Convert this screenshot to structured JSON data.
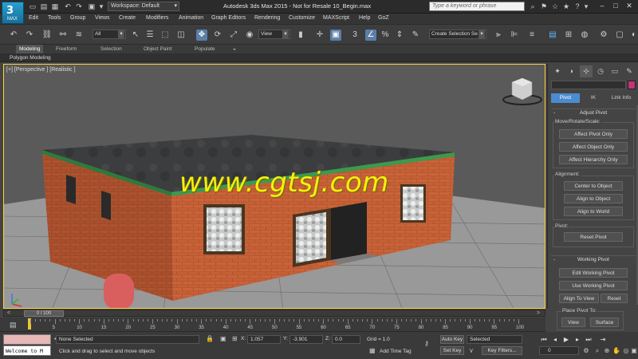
{
  "app": {
    "logo_text": "3",
    "logo_sub": "MAX",
    "window_title": "Autodesk 3ds Max  2015  - Not for Resale   10_Begin.max",
    "workspace_label": "Workspace: Default",
    "search_placeholder": "Type a keyword or phrase"
  },
  "menu": [
    "Edit",
    "Tools",
    "Group",
    "Views",
    "Create",
    "Modifiers",
    "Animation",
    "Graph Editors",
    "Rendering",
    "Customize",
    "MAXScript",
    "Help",
    "GoZ"
  ],
  "toolbar": {
    "filter_value": "All",
    "refcoord_value": "View",
    "selection_set_placeholder": "Create Selection Se"
  },
  "ribbon": {
    "tabs": [
      "Modeling",
      "Freeform",
      "Selection",
      "Object Paint",
      "Populate"
    ],
    "sub_label": "Polygon Modeling"
  },
  "viewport": {
    "label": "[+] [Perspective ] [Realistic ]",
    "watermark": "www.cgtsj.com"
  },
  "command_panel": {
    "hierarchy_tabs": [
      "Pivot",
      "IK",
      "Link Info"
    ],
    "adjust_pivot": {
      "title": "Adjust Pivot",
      "group_move": "Move/Rotate/Scale:",
      "buttons_move": [
        "Affect Pivot Only",
        "Affect Object Only",
        "Affect Hierarchy Only"
      ],
      "group_align": "Alignment:",
      "buttons_align": [
        "Center to Object",
        "Align to Object",
        "Align to World"
      ],
      "group_pivot": "Pivot:",
      "button_reset": "Reset Pivot"
    },
    "working_pivot": {
      "title": "Working Pivot",
      "btn_edit": "Edit Working Pivot",
      "btn_use": "Use Working Pivot",
      "btn_align_view": "Align To View",
      "btn_reset": "Reset",
      "group_place": "Place Pivot To:",
      "btn_view": "View",
      "btn_surface": "Surface"
    }
  },
  "timeline": {
    "frame_range": "0 / 100",
    "ticks": [
      "5",
      "10",
      "15",
      "20",
      "25",
      "30",
      "35",
      "40",
      "45",
      "50",
      "55",
      "60",
      "65",
      "70",
      "75",
      "80",
      "85",
      "90",
      "95",
      "100"
    ]
  },
  "status": {
    "listener_text": "Welcome to M",
    "selection": "None Selected",
    "prompt": "Click and drag to select and move objects",
    "x_label": "X:",
    "x_value": "1.057",
    "y_label": "Y:",
    "y_value": "-3.901",
    "z_label": "Z:",
    "z_value": "0.0",
    "grid": "Grid = 1.0",
    "add_time_tag": "Add Time Tag",
    "auto_key": "Auto Key",
    "set_key": "Set Key",
    "key_mode_value": "Selected",
    "key_filters": "Key Filters...",
    "current_frame": "0"
  }
}
